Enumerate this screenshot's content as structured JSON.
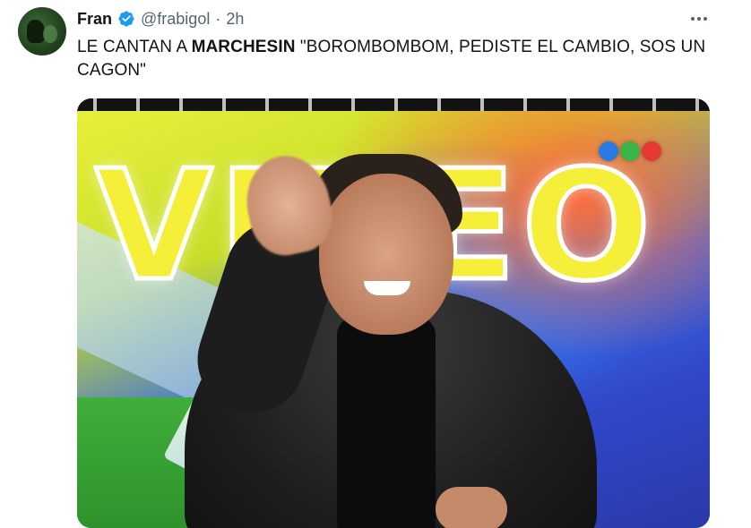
{
  "tweet": {
    "author": {
      "display_name": "Fran",
      "handle": "@frabigol",
      "separator": "·",
      "time": "2h",
      "verified": true,
      "avatar_icon": "avatar-image"
    },
    "text": {
      "part1": "LE CANTAN A ",
      "bold": "MARCHESIN",
      "part2": " \"BOROMBOMBOM, PEDISTE EL CAMBIO, SOS UN CAGON\""
    },
    "media": {
      "type": "video",
      "background_word": "VIDEO",
      "channel_logo_colors": [
        "#2c7be5",
        "#3bb54a",
        "#e53935"
      ]
    }
  },
  "colors": {
    "text_primary": "#0f1419",
    "text_secondary": "#536471",
    "verified_blue": "#1d9bf0"
  },
  "icons": {
    "verified": "verified-badge-icon",
    "more": "more-options-icon"
  }
}
